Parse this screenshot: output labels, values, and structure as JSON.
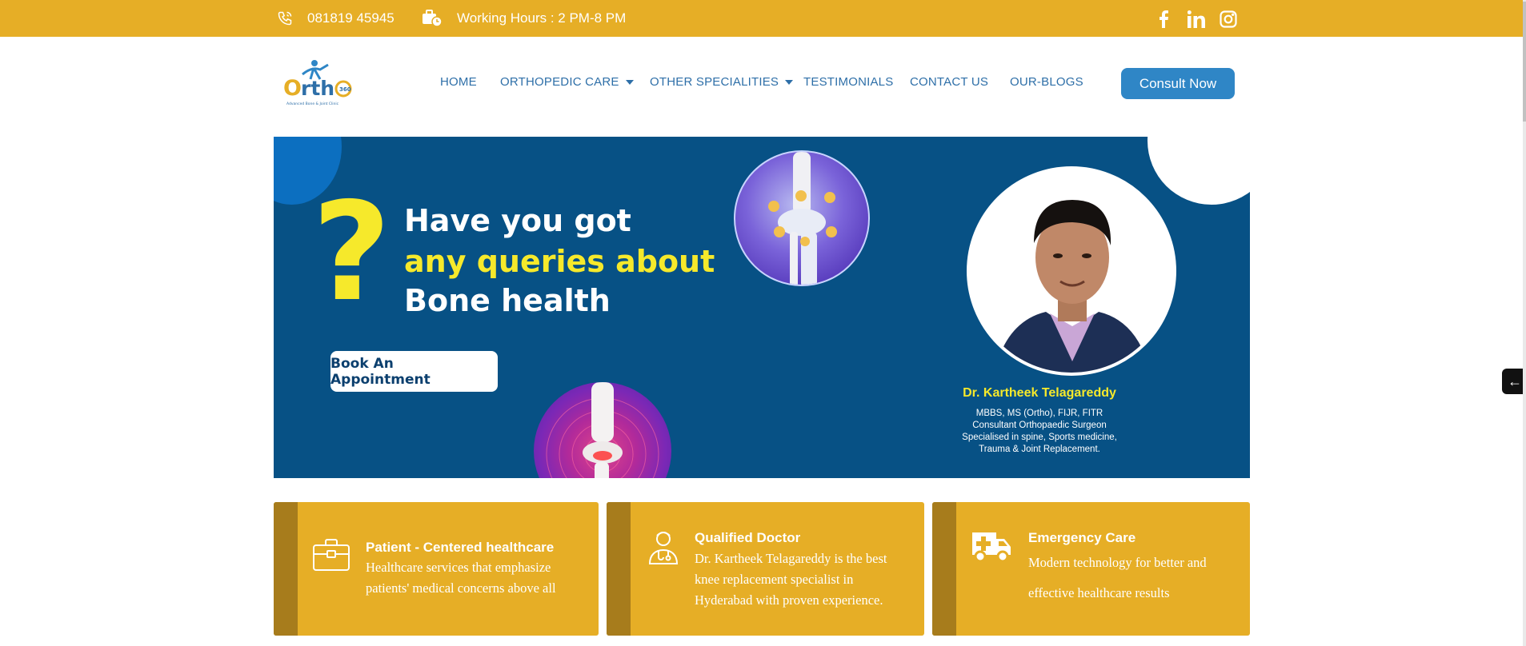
{
  "topbar": {
    "phone": "081819 45945",
    "hours": "Working Hours : 2 PM-8 PM",
    "social": [
      "facebook-icon",
      "linkedin-icon",
      "instagram-icon"
    ],
    "color": "#e6ae26"
  },
  "logo": {
    "main": "Orth",
    "sub": "Advanced Bone & Joint Clinic",
    "badge": "360"
  },
  "nav": {
    "items": [
      "HOME",
      "ORTHOPEDIC CARE",
      "OTHER SPECIALITIES",
      "TESTIMONIALS",
      "CONTACT US",
      "OUR-BLOGS"
    ],
    "cta": "Consult Now"
  },
  "hero": {
    "question": "?",
    "line1": "Have you got",
    "line2": "any queries about",
    "line3": "Bone health",
    "button": "Book An Appointment",
    "doctor_name": "Dr. Kartheek Telagareddy",
    "doctor_lines": [
      "MBBS, MS (Ortho), FIJR, FITR",
      "Consultant Orthopaedic Surgeon",
      "Specialised in spine, Sports medicine,",
      "Trauma & Joint Replacement."
    ],
    "bg_color": "#075185",
    "accent": "#f6e92b"
  },
  "features": [
    {
      "icon": "briefcase-icon",
      "title": "Patient - Centered healthcare",
      "desc": [
        "Healthcare services that emphasize",
        "patients' medical concerns above all"
      ]
    },
    {
      "icon": "doctor-icon",
      "title": "Qualified Doctor",
      "desc": [
        "Dr. Kartheek Telagareddy is the best",
        "knee replacement specialist in",
        "Hyderabad with proven experience."
      ]
    },
    {
      "icon": "ambulance-icon",
      "title": "Emergency Care",
      "desc": [
        "Modern technology for better and",
        "effective healthcare results"
      ]
    }
  ],
  "side_tab": "←"
}
